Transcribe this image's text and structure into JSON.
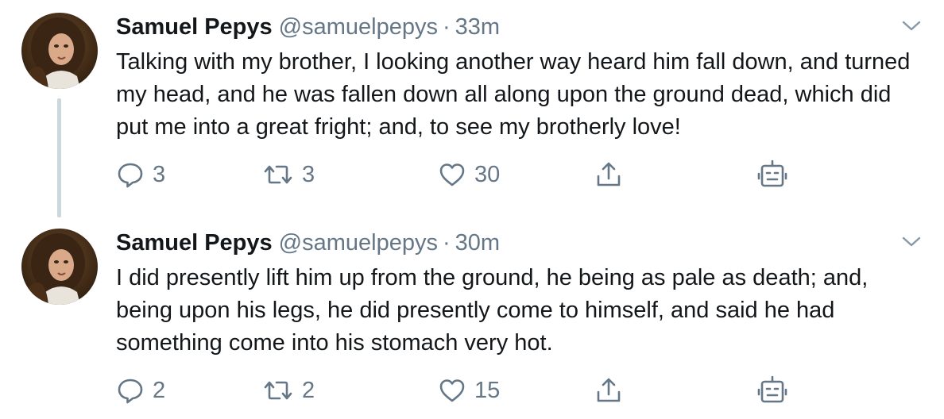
{
  "tweets": [
    {
      "author": {
        "name": "Samuel Pepys",
        "handle": "@samuelpepys",
        "avatar_icon": "portrait-avatar"
      },
      "separator": "·",
      "time": "33m",
      "text": "Talking with my brother, I looking another way heard him fall down, and turned my head, and he was fallen down all along upon the ground dead, which did put me into a great fright; and, to see my brotherly love!",
      "replies": "3",
      "retweets": "3",
      "likes": "30"
    },
    {
      "author": {
        "name": "Samuel Pepys",
        "handle": "@samuelpepys",
        "avatar_icon": "portrait-avatar"
      },
      "separator": "·",
      "time": "30m",
      "text": "I did presently lift him up from the ground, he being as pale as death; and, being upon his legs, he did presently come to himself, and said he had something come into his stomach very hot.",
      "replies": "2",
      "retweets": "2",
      "likes": "15"
    }
  ],
  "colors": {
    "text": "#14171a",
    "secondary": "#657786",
    "thread_line": "#ccd6dd"
  },
  "icons": [
    "reply-icon",
    "retweet-icon",
    "like-icon",
    "share-icon",
    "bot-icon",
    "chevron-down-icon"
  ]
}
